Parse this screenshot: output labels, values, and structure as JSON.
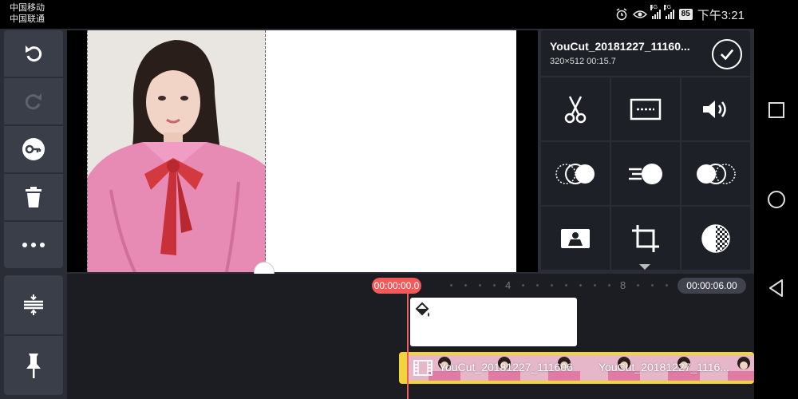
{
  "status_bar": {
    "carrier_1": "中国移动",
    "carrier_2": "中国联通",
    "sim1_tag": "4G",
    "sim2_tag": "2G",
    "battery": "85",
    "time": "下午3:21"
  },
  "clip": {
    "title": "YouCut_20181227_11160...",
    "meta": "320×512  00:15.7"
  },
  "timeline": {
    "current_time": "00:00:00.0",
    "end_time": "00:00:06.00",
    "ruler_labels": [
      "4",
      "8"
    ],
    "video_labels": [
      "YouCut_20181227_111606",
      "YouCut_20181227_1116..."
    ]
  },
  "icons": {
    "left_tools": [
      "undo-icon",
      "redo-icon",
      "keyframe-icon",
      "delete-icon",
      "more-icon"
    ],
    "edit_grid": [
      "scissors-icon",
      "subtitle-icon",
      "volume-icon",
      "transition-icon",
      "speed-icon",
      "blend-icon",
      "chroma-key-icon",
      "crop-icon",
      "opacity-icon"
    ],
    "timeline_tools": [
      "split-view-icon",
      "pin-icon"
    ],
    "nav": [
      "recent-apps-icon",
      "home-icon",
      "back-icon"
    ]
  },
  "colors": {
    "accent_red": "#f05a5a",
    "clip_yellow": "#f2d43c",
    "panel_dark": "#1e2027"
  }
}
